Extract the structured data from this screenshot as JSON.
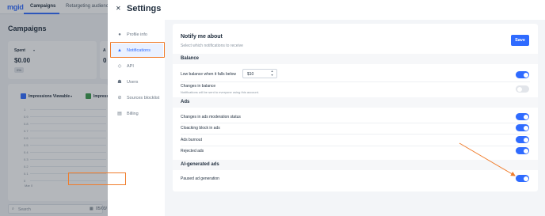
{
  "app": {
    "logo": "mgid",
    "tabs": [
      {
        "label": "Campaigns",
        "active": true
      },
      {
        "label": "Retargeting audience"
      }
    ],
    "page_title": "Campaigns",
    "cards": [
      {
        "label": "Spent",
        "value": "$0.00",
        "pill": "0%"
      },
      {
        "label": "A",
        "value": "0",
        "pill": "0"
      }
    ],
    "legend": [
      {
        "label": "Impressions Viewable",
        "color": "#2f6bff"
      },
      {
        "label": "Impress",
        "color": "#3a9a4a"
      }
    ],
    "yticks": [
      "1",
      "0.9",
      "0.8",
      "0.7",
      "0.6",
      "0.5",
      "0.4",
      "0.3",
      "0.2",
      "0.1",
      "0"
    ],
    "x_first_tick": "Mar 0",
    "search_placeholder": "Search",
    "date_value": "05/03/"
  },
  "settings": {
    "title": "Settings",
    "close_icon": "close-icon",
    "nav": [
      {
        "label": "Profile info",
        "icon": "person-icon"
      },
      {
        "label": "Notifications",
        "icon": "bell-icon",
        "active": true
      },
      {
        "label": "API",
        "icon": "api-icon"
      },
      {
        "label": "Users",
        "icon": "users-icon"
      },
      {
        "label": "Sources blocklist",
        "icon": "block-icon"
      },
      {
        "label": "Billing",
        "icon": "billing-icon"
      }
    ],
    "notify": {
      "heading": "Notify me about",
      "subtitle": "Select which notifications to receive",
      "save_label": "Save"
    },
    "sections": {
      "balance": "Balance",
      "ads": "Ads",
      "ai": "AI-generated ads"
    },
    "rows": {
      "low_balance": {
        "label": "Low balance when it falls below",
        "value": "$10",
        "enabled": true
      },
      "changes_in_balance": {
        "label": "Changes in balance",
        "note": "Notifications will be sent to everyone using this account.",
        "enabled": false
      },
      "moderation": {
        "label": "Changes in ads moderation status",
        "enabled": true
      },
      "cloacking": {
        "label": "Cloacking block in ads",
        "enabled": true
      },
      "burnout": {
        "label": "Ads burnout",
        "enabled": true
      },
      "rejected": {
        "label": "Rejected ads",
        "enabled": true
      },
      "paused_gen": {
        "label": "Paused ad generation",
        "enabled": true
      }
    },
    "accent_color": "#2f6bff",
    "highlight_color": "#f07d2c"
  }
}
